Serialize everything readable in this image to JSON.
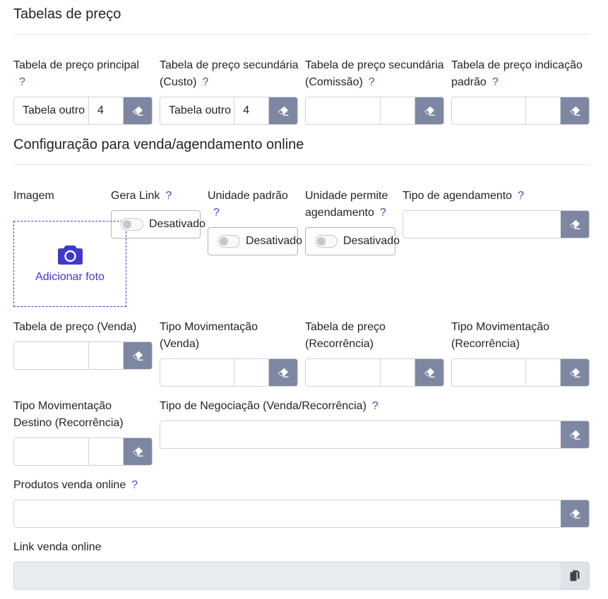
{
  "section1": {
    "title": "Tabelas de preço"
  },
  "price_tables": [
    {
      "label": "Tabela de preço principal",
      "help": "?",
      "name": "Tabela outro",
      "code": "4"
    },
    {
      "label": "Tabela de preço secundária (Custo)",
      "help": "?",
      "name": "Tabela outro",
      "code": "4"
    },
    {
      "label": "Tabela de preço secundária (Comissão)",
      "help": "?",
      "name": "",
      "code": ""
    },
    {
      "label": "Tabela de preço indicação padrão",
      "help": "?",
      "name": "",
      "code": ""
    }
  ],
  "section2": {
    "title": "Configuração para venda/agendamento online"
  },
  "image": {
    "label": "Imagem",
    "add_photo": "Adicionar foto",
    "icon": "camera-icon"
  },
  "gera_link": {
    "label": "Gera Link",
    "help": "?",
    "state": "Desativado",
    "checked": false
  },
  "unidade_padrao": {
    "label": "Unidade padrão",
    "help": "?",
    "state": "Desativado",
    "checked": false
  },
  "unidade_permite": {
    "label": "Unidade permite agendamento",
    "help": "?",
    "state": "Desativado",
    "checked": false
  },
  "tipo_agendamento": {
    "label": "Tipo de agendamento",
    "help": "?",
    "value": ""
  },
  "row_venda": [
    {
      "label": "Tabela de preço (Venda)",
      "name": "",
      "code": ""
    },
    {
      "label": "Tipo Movimentação (Venda)",
      "name": "",
      "code": ""
    },
    {
      "label": "Tabela de preço (Recorrência)",
      "name": "",
      "code": ""
    },
    {
      "label": "Tipo Movimentação (Recorrência)",
      "name": "",
      "code": ""
    }
  ],
  "tipo_mov_destino": {
    "label": "Tipo Movimentação Destino (Recorrência)",
    "name": "",
    "code": ""
  },
  "tipo_negociacao": {
    "label": "Tipo de Negociação (Venda/Recorrência)",
    "help": "?",
    "value": ""
  },
  "produtos_online": {
    "label": "Produtos venda online",
    "help": "?",
    "value": ""
  },
  "link_online": {
    "label": "Link venda online",
    "value": "",
    "copy_icon": "copy-icon"
  },
  "colors": {
    "accent": "#3f3acb",
    "clear_button": "#7d87a1",
    "help": "#3f51b5"
  }
}
